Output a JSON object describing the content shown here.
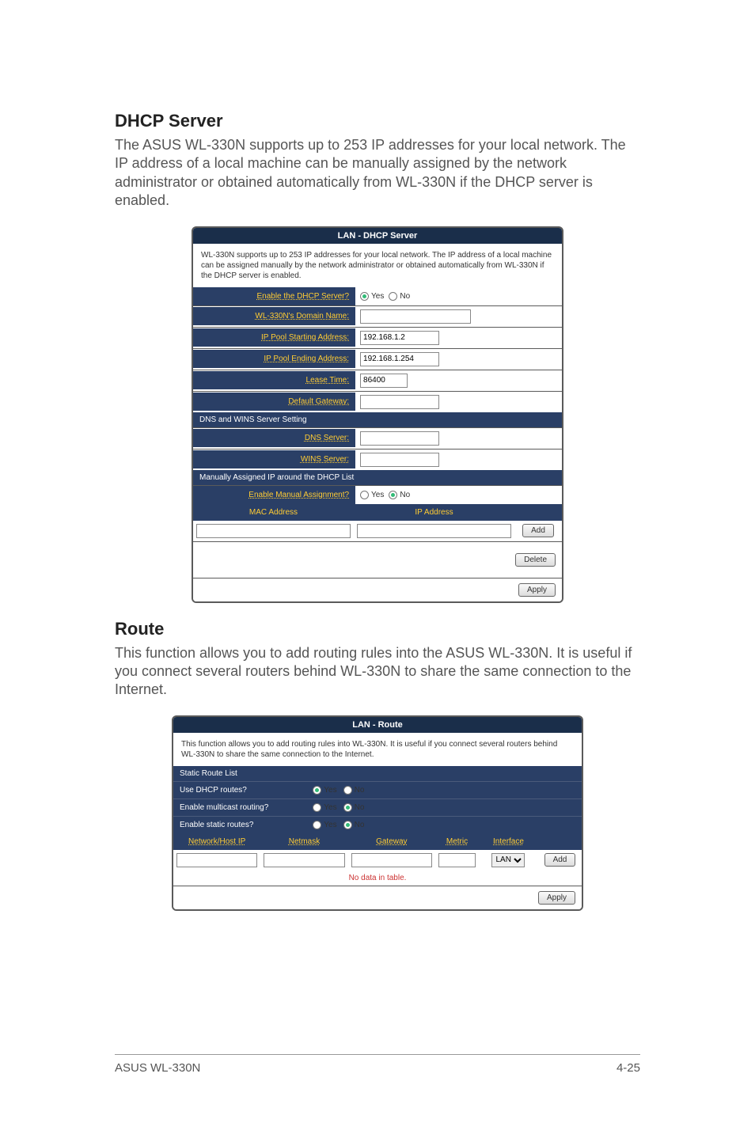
{
  "headings": {
    "dhcp_title": "DHCP Server",
    "dhcp_para": "The ASUS WL-330N supports up to 253 IP addresses for your local network. The IP address of a local machine can be manually assigned by the network administrator or obtained automatically from WL-330N if the DHCP server is enabled.",
    "route_title": "Route",
    "route_para": "This function allows you to add routing rules into the ASUS WL-330N. It is useful if you connect several routers behind WL-330N to share the same connection to the Internet."
  },
  "dhcp_panel": {
    "title": "LAN - DHCP Server",
    "intro": "WL-330N supports up to 253 IP addresses for your local network. The IP address of a local machine can be assigned manually by the network administrator or obtained automatically from WL-330N if the DHCP server is enabled.",
    "labels": {
      "enable_server": "Enable the DHCP Server?",
      "domain_name": "WL-330N's Domain Name:",
      "pool_start": "IP Pool Starting Address:",
      "pool_end": "IP Pool Ending Address:",
      "lease_time": "Lease Time:",
      "default_gw": "Default Gateway:"
    },
    "values": {
      "pool_start": "192.168.1.2",
      "pool_end": "192.168.1.254",
      "lease_time": "86400",
      "domain_name": "",
      "default_gw": ""
    },
    "sub_dns": "DNS and WINS Server Setting",
    "labels2": {
      "dns": "DNS Server:",
      "wins": "WINS Server:"
    },
    "values2": {
      "dns": "",
      "wins": ""
    },
    "sub_manual": "Manually Assigned IP around the DHCP List",
    "manual": {
      "enable_label": "Enable Manual Assignment?",
      "mac_h": "MAC Address",
      "ip_h": "IP Address",
      "mac_val": "",
      "ip_val": ""
    },
    "radio": {
      "yes": "Yes",
      "no": "No"
    },
    "buttons": {
      "add": "Add",
      "delete": "Delete",
      "apply": "Apply"
    }
  },
  "route_panel": {
    "title": "LAN - Route",
    "intro": "This function allows you to add routing rules into WL-330N. It is useful if you connect several routers behind WL-330N to share the same connection to the Internet.",
    "sub_static": "Static Route List",
    "options": {
      "use_dhcp": "Use DHCP routes?",
      "multicast": "Enable multicast routing?",
      "static": "Enable static routes?"
    },
    "radio": {
      "yes": "Yes",
      "no": "No"
    },
    "table": {
      "h_network": "Network/Host IP",
      "h_netmask": "Netmask",
      "h_gateway": "Gateway",
      "h_metric": "Metric",
      "h_interface": "Interface",
      "iface_selected": "LAN",
      "no_data": "No data in table.",
      "net_val": "",
      "mask_val": "",
      "gw_val": "",
      "metric_val": ""
    },
    "buttons": {
      "add": "Add",
      "apply": "Apply"
    }
  },
  "footer": {
    "left": "ASUS WL-330N",
    "right": "4-25"
  }
}
